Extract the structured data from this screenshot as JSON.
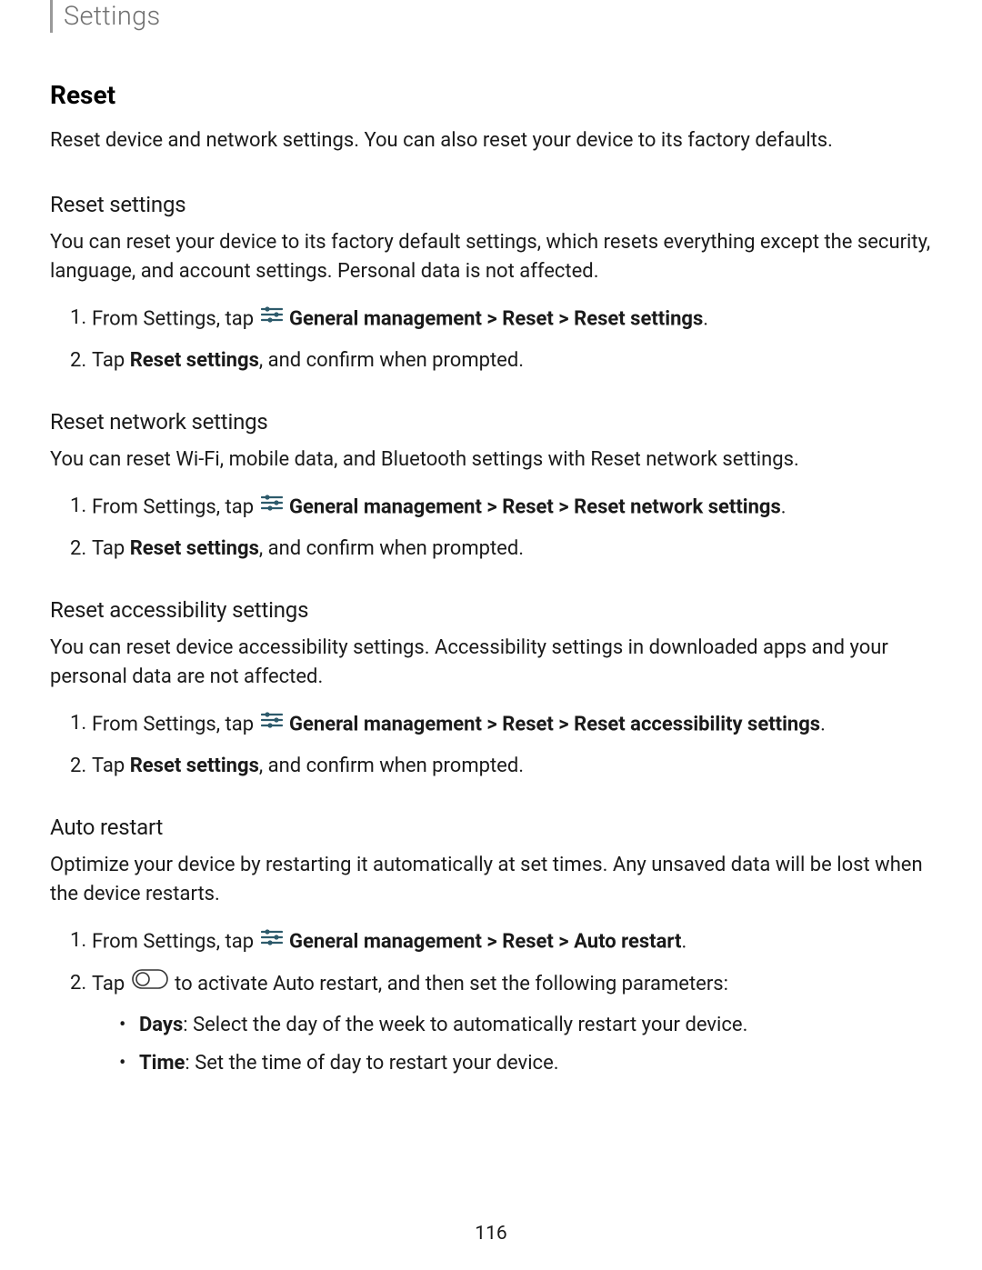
{
  "breadcrumb": "Settings",
  "title": "Reset",
  "intro": "Reset device and network settings. You can also reset your device to its factory defaults.",
  "pageNumber": "116",
  "sections": {
    "resetSettings": {
      "heading": "Reset settings",
      "desc": "You can reset your device to its factory default settings, which resets everything except the security, language, and account settings. Personal data is not affected.",
      "step1_prefix": "From Settings, tap ",
      "step1_path": " General management > Reset > Reset settings",
      "step1_suffix": ".",
      "step2_prefix": "Tap ",
      "step2_bold": "Reset settings",
      "step2_suffix": ", and confirm when prompted."
    },
    "resetNetwork": {
      "heading": "Reset network settings",
      "desc": "You can reset Wi-Fi, mobile data, and Bluetooth settings with Reset network settings.",
      "step1_prefix": "From Settings, tap ",
      "step1_path": " General management > Reset > Reset network settings",
      "step1_suffix": ".",
      "step2_prefix": "Tap ",
      "step2_bold": "Reset settings",
      "step2_suffix": ", and confirm when prompted."
    },
    "resetAccessibility": {
      "heading": "Reset accessibility settings",
      "desc": "You can reset device accessibility settings. Accessibility settings in downloaded apps and your personal data are not affected.",
      "step1_prefix": "From Settings, tap ",
      "step1_path": " General management > Reset > Reset accessibility settings",
      "step1_suffix": ".",
      "step2_prefix": "Tap ",
      "step2_bold": "Reset settings",
      "step2_suffix": ", and confirm when prompted."
    },
    "autoRestart": {
      "heading": "Auto restart",
      "desc": "Optimize your device by restarting it automatically at set times. Any unsaved data will be lost when the device restarts.",
      "step1_prefix": "From Settings, tap ",
      "step1_path": " General management > Reset > Auto restart",
      "step1_suffix": ".",
      "step2_prefix": "Tap ",
      "step2_suffix": " to activate Auto restart, and then set the following parameters:",
      "bullet1_bold": "Days",
      "bullet1_text": ": Select the day of the week to automatically restart your device.",
      "bullet2_bold": "Time",
      "bullet2_text": ": Set the time of day to restart your device."
    }
  }
}
